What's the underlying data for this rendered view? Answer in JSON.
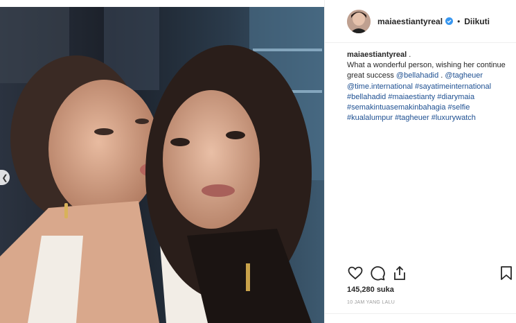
{
  "post": {
    "username": "maiaestiantyreal",
    "follow_status": "Diikuti",
    "dot": "•",
    "caption": {
      "user": "maiaestiantyreal",
      "sep": " .",
      "text": "What a wonderful person, wishing her continue great success ",
      "tags": [
        "@bellahadid",
        "@tagheuer",
        "@time.international",
        "#sayatimeinternational",
        "#bellahadid",
        "#maiaestianty",
        "#diarymaia",
        "#semakintuasemakinbahagia",
        "#selfie",
        "#kualalumpur",
        "#tagheuer",
        "#luxurywatch"
      ]
    },
    "likes": "145,280 suka",
    "timestamp": "10 JAM YANG LALU"
  },
  "icons": {
    "prev": "chevron-left-icon",
    "like": "heart-icon",
    "comment": "comment-icon",
    "share": "share-icon",
    "save": "bookmark-icon",
    "verified": "verified-badge-icon"
  },
  "colors": {
    "link": "#1d4f91",
    "verified": "#3897f0",
    "text": "#262626",
    "muted": "#999999"
  }
}
